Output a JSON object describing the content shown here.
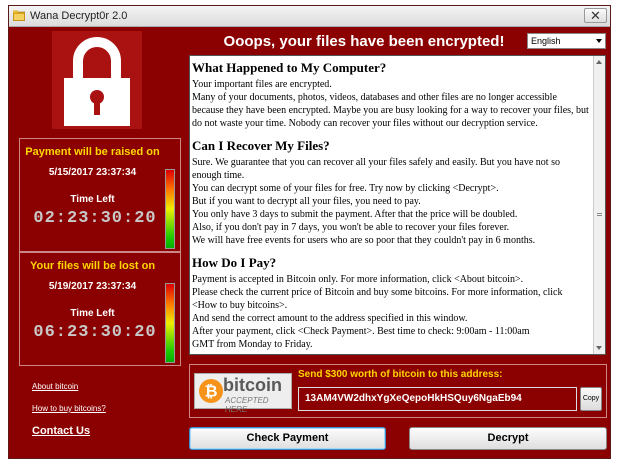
{
  "window": {
    "title": "Wana Decrypt0r 2.0",
    "close_glyph": "✕"
  },
  "header": {
    "headline": "Ooops, your files have been encrypted!",
    "language": "English"
  },
  "timers": [
    {
      "title": "Payment will be raised on",
      "date": "5/15/2017 23:37:34",
      "time_left_label": "Time Left",
      "countdown": "02:23:30:20"
    },
    {
      "title": "Your files will be lost on",
      "date": "5/19/2017 23:37:34",
      "time_left_label": "Time Left",
      "countdown": "06:23:30:20"
    }
  ],
  "links": {
    "about_bitcoin": "About bitcoin",
    "how_to_buy": "How to buy bitcoins?",
    "contact": "Contact Us"
  },
  "message": {
    "sections": [
      {
        "heading": "What Happened to My Computer?",
        "paragraphs": [
          "Your important files are encrypted.",
          "Many of your documents, photos, videos, databases and other files are no longer accessible because they have been encrypted. Maybe you are busy looking for a way to recover your files, but do not waste your time. Nobody can recover your files without our decryption service."
        ]
      },
      {
        "heading": "Can I Recover My Files?",
        "paragraphs": [
          "Sure. We guarantee that you can recover all your files safely and easily. But you have not so enough time.",
          "You can decrypt some of your files for free. Try now by clicking <Decrypt>.",
          "But if you want to decrypt all your files, you need to pay.",
          "You only have 3 days to submit the payment. After that the price will be doubled.",
          "Also, if you don't pay in 7 days, you won't be able to recover your files forever.",
          "We will have free events for users who are so poor that they couldn't pay in 6 months."
        ]
      },
      {
        "heading": "How Do I Pay?",
        "paragraphs": [
          "Payment is accepted in Bitcoin only. For more information, click <About bitcoin>.",
          "Please check the current price of Bitcoin and buy some bitcoins. For more information, click <How to buy bitcoins>.",
          "And send the correct amount to the address specified in this window.",
          "After your payment, click <Check Payment>. Best time to check: 9:00am - 11:00am",
          "GMT from Monday to Friday."
        ]
      }
    ]
  },
  "payment": {
    "logo_word": "bitcoin",
    "logo_tagline": "ACCEPTED HERE",
    "send_text": "Send $300 worth of bitcoin to this address:",
    "address": "13AM4VW2dhxYgXeQepoHkHSQuy6NgaEb94",
    "copy_label": "Copy"
  },
  "buttons": {
    "check_payment": "Check Payment",
    "decrypt": "Decrypt"
  },
  "colors": {
    "background": "#8b0000",
    "timer_title": "#ffd700",
    "countdown": "#c8c8c8",
    "focus_border": "#3a8fd0"
  }
}
